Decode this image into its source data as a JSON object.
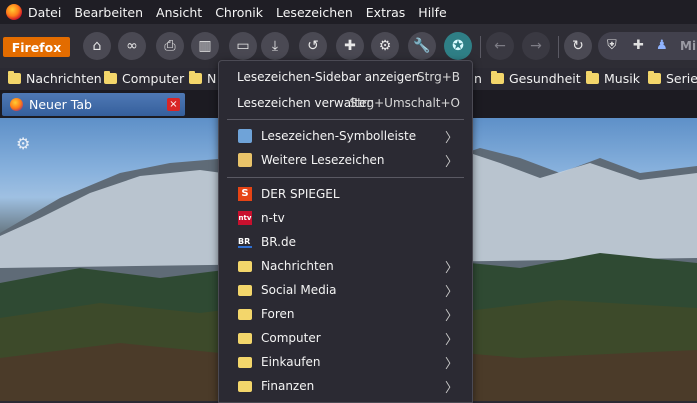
{
  "menubar": {
    "items": [
      "Datei",
      "Bearbeiten",
      "Ansicht",
      "Chronik",
      "Lesezeichen",
      "Extras",
      "Hilfe"
    ]
  },
  "toolbar": {
    "app_button": "Firefox",
    "url_partial": "Mi"
  },
  "bookmarks_bar": {
    "left": [
      "Nachrichten",
      "Computer",
      "N"
    ],
    "right_partial": "n",
    "right": [
      "Gesundheit",
      "Musik",
      "Serie"
    ]
  },
  "tab": {
    "title": "Neuer Tab",
    "close": "×"
  },
  "menu": {
    "show_sidebar": {
      "label": "Lesezeichen-Sidebar anzeigen",
      "shortcut": "Strg+B"
    },
    "manage": {
      "label": "Lesezeichen verwalten",
      "shortcut": "Strg+Umschalt+O"
    },
    "toolbar_folder": {
      "label": "Lesezeichen-Symbolleiste"
    },
    "other_folder": {
      "label": "Weitere Lesezeichen"
    },
    "bookmarks": [
      {
        "label": "DER SPIEGEL",
        "icon": "spiegel-icon",
        "glyph": "S"
      },
      {
        "label": "n-tv",
        "icon": "ntv-icon",
        "glyph": "ntv"
      },
      {
        "label": "BR.de",
        "icon": "br-icon",
        "glyph": "BR"
      }
    ],
    "folders": [
      "Nachrichten",
      "Social Media",
      "Foren",
      "Computer",
      "Einkaufen",
      "Finanzen"
    ]
  }
}
